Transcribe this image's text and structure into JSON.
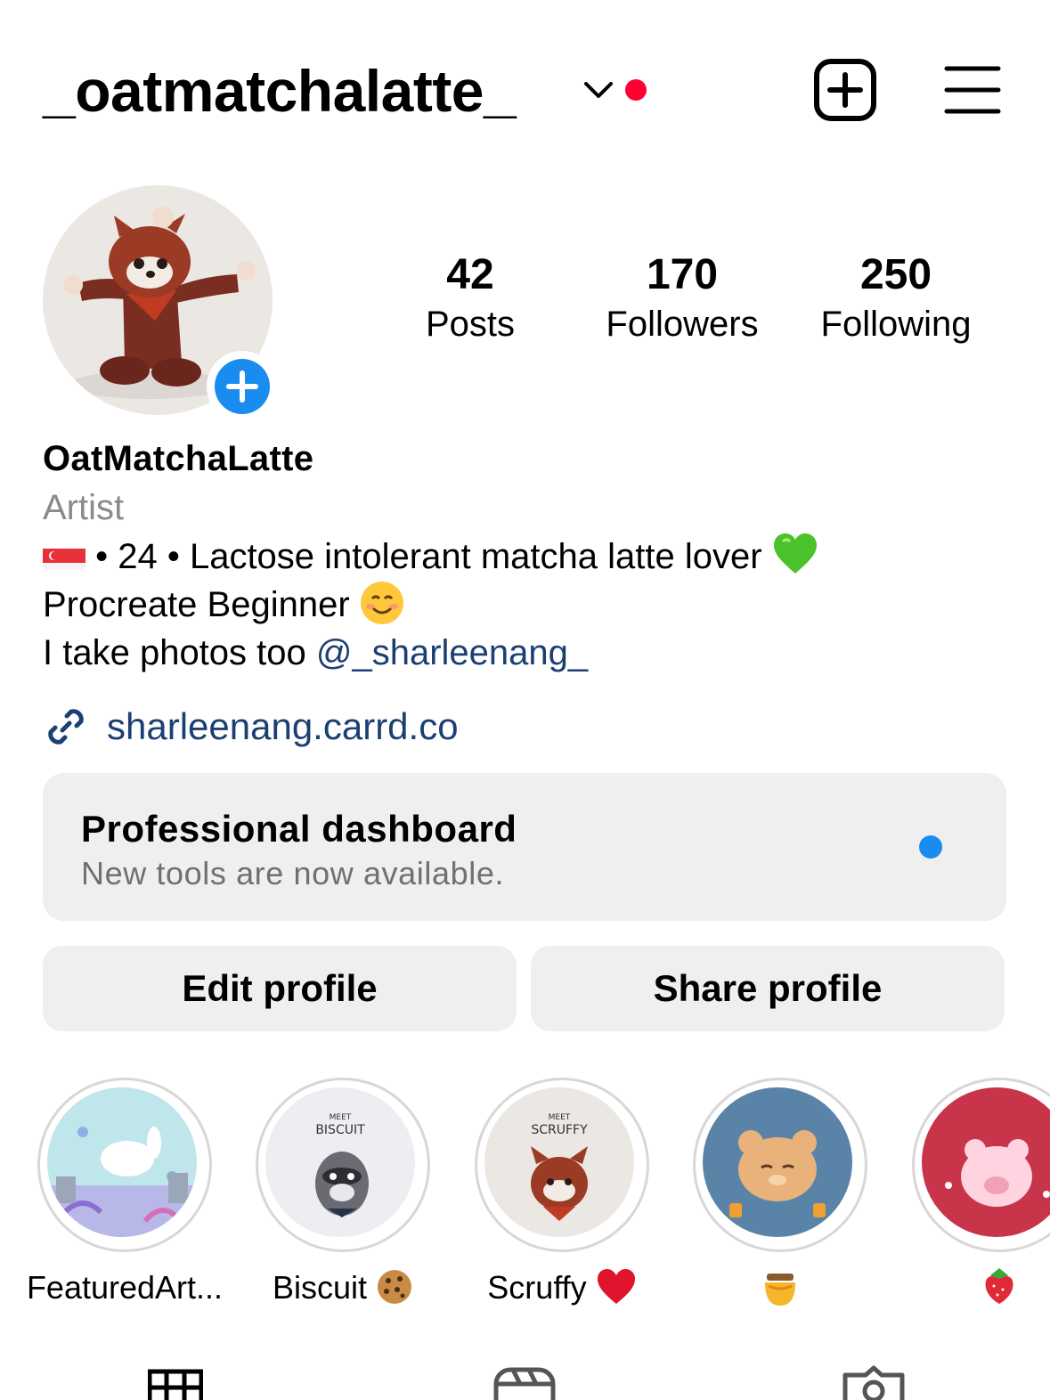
{
  "header": {
    "username": "_oatmatchalatte_",
    "accent_dot_color": "#ff0033"
  },
  "stats": [
    {
      "value": "42",
      "label": "Posts"
    },
    {
      "value": "170",
      "label": "Followers"
    },
    {
      "value": "250",
      "label": "Following"
    }
  ],
  "bio": {
    "display_name": "OatMatchaLatte",
    "category": "Artist",
    "line1_text": " • 24 • Lactose intolerant matcha latte lover ",
    "line2_text": "Procreate Beginner ",
    "line3_text": "I take photos too ",
    "mention": "@_sharleenang_",
    "link": "sharleenang.carrd.co"
  },
  "dashboard": {
    "title": "Professional dashboard",
    "subtitle": "New tools are now available.",
    "dot_color": "#1a8cf0"
  },
  "buttons": {
    "edit": "Edit profile",
    "share": "Share profile"
  },
  "highlights": [
    {
      "label": "FeaturedArt...",
      "icon": "featured-art-thumbnail"
    },
    {
      "label": "Biscuit ",
      "icon": "biscuit-raccoon-thumbnail",
      "emoji": "cookie-icon"
    },
    {
      "label": "Scruffy ",
      "icon": "scruffy-red-panda-thumbnail",
      "emoji": "heart-icon"
    },
    {
      "label": "",
      "icon": "bear-thumbnail",
      "emoji": "honey-pot-icon"
    },
    {
      "label": "",
      "icon": "pink-bear-thumbnail",
      "emoji": "strawberry-icon"
    }
  ],
  "colors": {
    "blue_add": "#1a8cf0",
    "link_blue": "#1b3f73"
  }
}
